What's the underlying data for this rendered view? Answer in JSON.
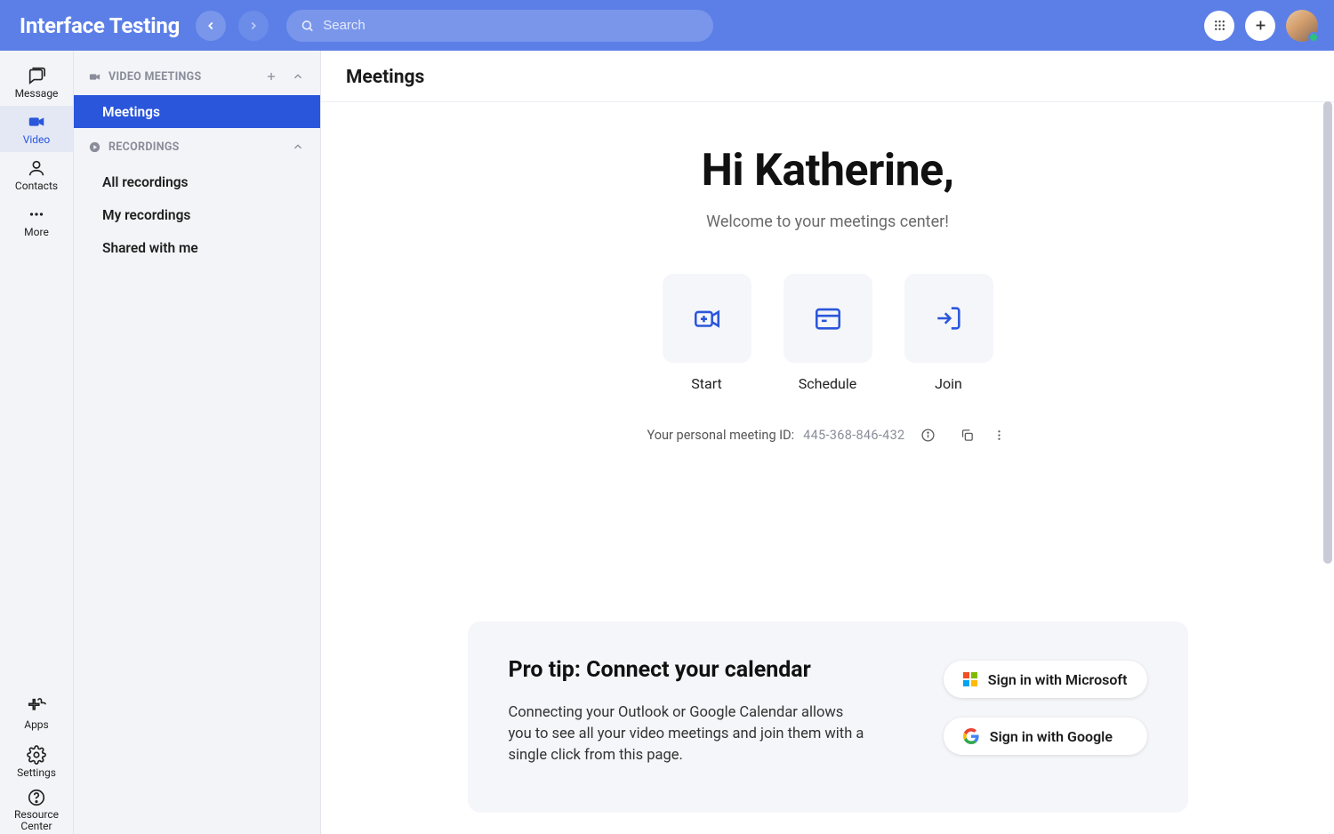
{
  "header": {
    "app_title": "Interface Testing",
    "search_placeholder": "Search"
  },
  "rail": {
    "items": [
      {
        "key": "message",
        "label": "Message",
        "active": false
      },
      {
        "key": "video",
        "label": "Video",
        "active": true
      },
      {
        "key": "contacts",
        "label": "Contacts",
        "active": false
      },
      {
        "key": "more",
        "label": "More",
        "active": false
      }
    ],
    "bottom": [
      {
        "key": "apps",
        "label": "Apps"
      },
      {
        "key": "settings",
        "label": "Settings"
      },
      {
        "key": "resource",
        "label": "Resource",
        "label2": "Center"
      }
    ]
  },
  "panel": {
    "groups": [
      {
        "key": "video_meetings",
        "title": "VIDEO MEETINGS",
        "has_add": true,
        "items": [
          {
            "key": "meetings",
            "label": "Meetings",
            "selected": true
          }
        ]
      },
      {
        "key": "recordings",
        "title": "RECORDINGS",
        "has_add": false,
        "items": [
          {
            "key": "all_recordings",
            "label": "All recordings",
            "selected": false
          },
          {
            "key": "my_recordings",
            "label": "My recordings",
            "selected": false
          },
          {
            "key": "shared_with_me",
            "label": "Shared with me",
            "selected": false
          }
        ]
      }
    ]
  },
  "main": {
    "title": "Meetings",
    "greeting": "Hi Katherine,",
    "subgreet": "Welcome to your meetings center!",
    "actions": [
      {
        "key": "start",
        "label": "Start"
      },
      {
        "key": "schedule",
        "label": "Schedule"
      },
      {
        "key": "join",
        "label": "Join"
      }
    ],
    "pmi_label": "Your personal meeting ID:",
    "pmi_value": "445-368-846-432"
  },
  "protip": {
    "title": "Pro tip: Connect your calendar",
    "body": "Connecting your Outlook or Google Calendar allows you to see all your video meetings and join them with a single click from this page.",
    "microsoft_label": "Sign in with Microsoft",
    "google_label": "Sign in with Google"
  }
}
